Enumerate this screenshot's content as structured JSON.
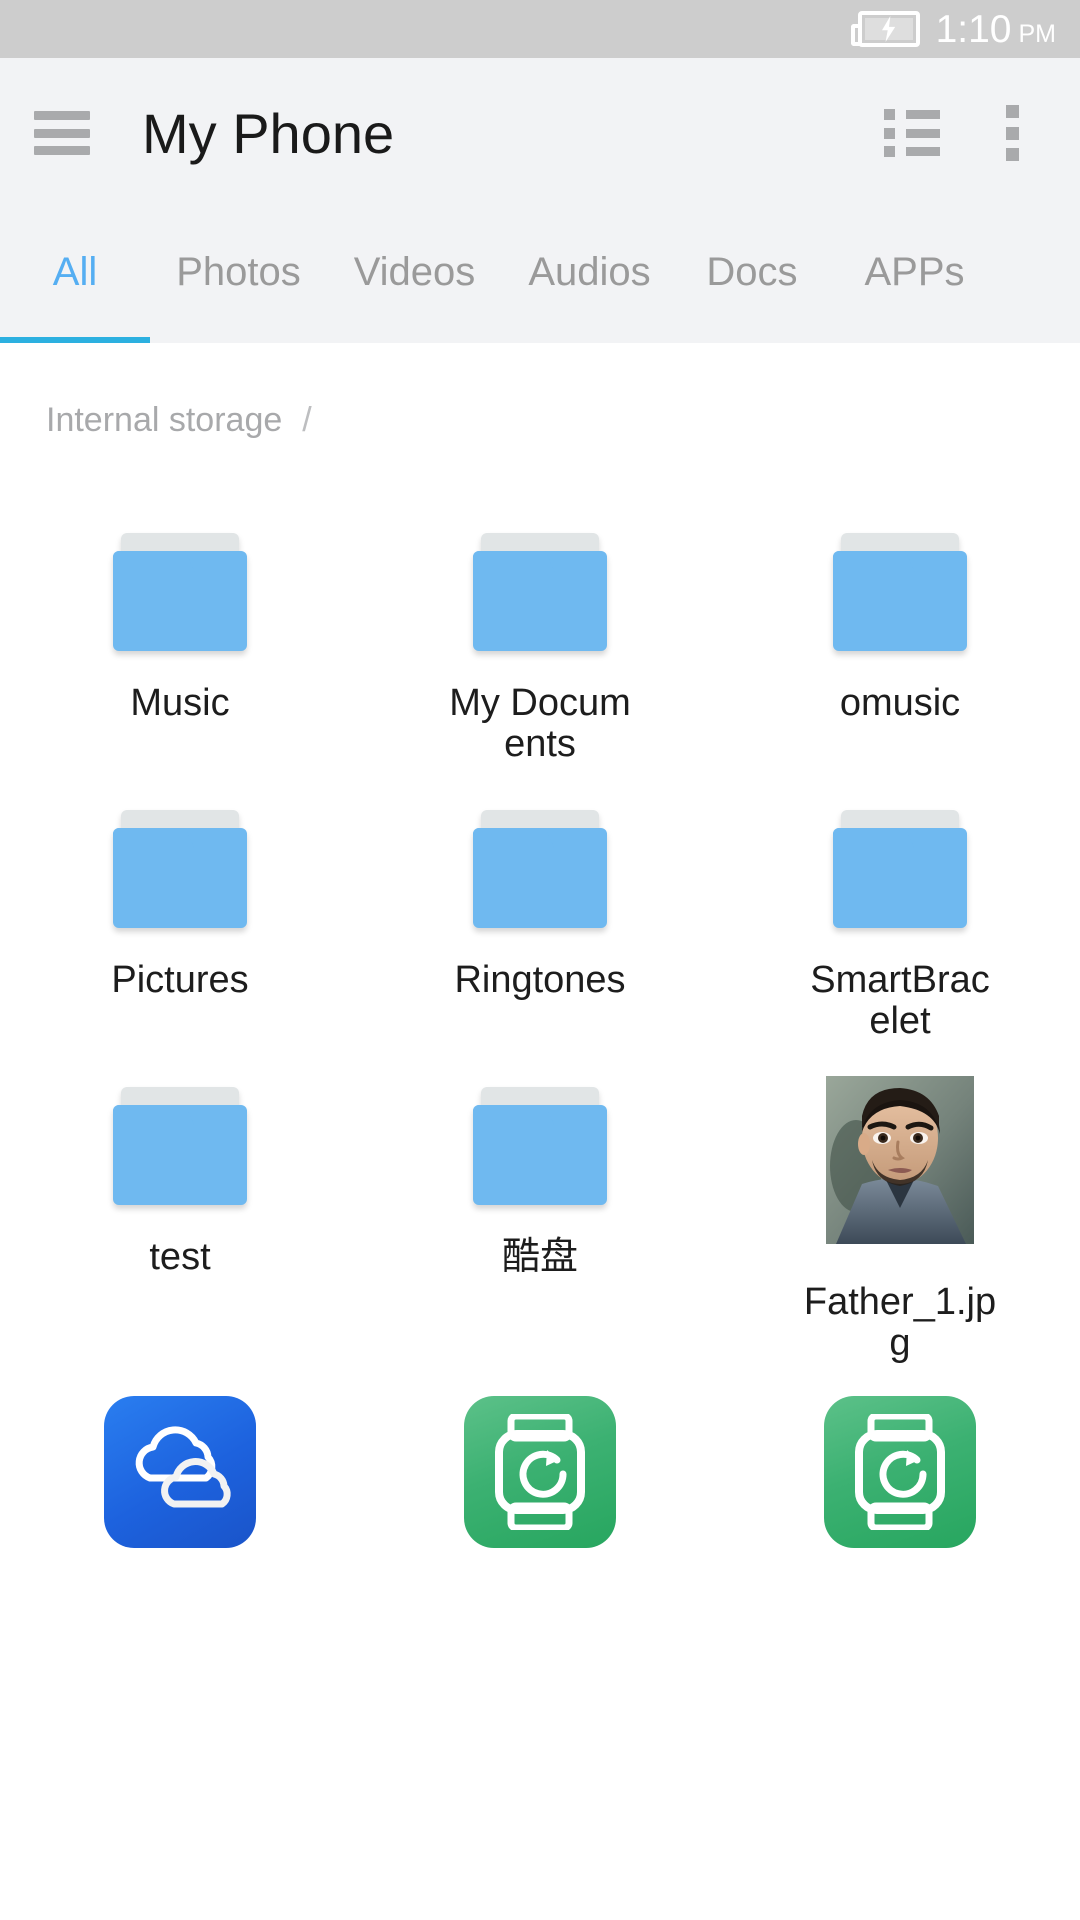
{
  "statusbar": {
    "time": "1:10",
    "ampm": "PM",
    "battery_icon": "battery-charging-icon"
  },
  "appbar": {
    "menu_icon": "hamburger-menu-icon",
    "title": "My Phone",
    "list_view_icon": "list-view-icon",
    "overflow_icon": "overflow-menu-icon"
  },
  "tabs": {
    "active": "All",
    "items": [
      {
        "label": "All"
      },
      {
        "label": "Photos"
      },
      {
        "label": "Videos"
      },
      {
        "label": "Audios"
      },
      {
        "label": "Docs"
      },
      {
        "label": "APPs"
      }
    ]
  },
  "breadcrumb": {
    "root": "Internal storage",
    "separator": "/"
  },
  "files": [
    {
      "name": "Music",
      "type": "folder"
    },
    {
      "name": "My Documents",
      "type": "folder"
    },
    {
      "name": "omusic",
      "type": "folder"
    },
    {
      "name": "Pictures",
      "type": "folder"
    },
    {
      "name": "Ringtones",
      "type": "folder"
    },
    {
      "name": "SmartBracelet",
      "type": "folder"
    },
    {
      "name": "test",
      "type": "folder"
    },
    {
      "name": "酷盘",
      "type": "folder"
    },
    {
      "name": "Father_1.jpg",
      "type": "image"
    },
    {
      "name": "",
      "type": "app-cloud"
    },
    {
      "name": "",
      "type": "app-watch"
    },
    {
      "name": "",
      "type": "app-watch"
    }
  ],
  "colors": {
    "accent": "#2cb0e0",
    "tab_active_text": "#55aef2",
    "folder_blue": "#6fb9f0",
    "folder_back": "#e1e5e6",
    "appbar_bg": "#f2f3f5",
    "statusbar_bg": "#cdcdcd",
    "muted_text": "#9a9a9a",
    "cloud_app_blue": "#1d62de",
    "watch_app_green": "#3cb172"
  }
}
